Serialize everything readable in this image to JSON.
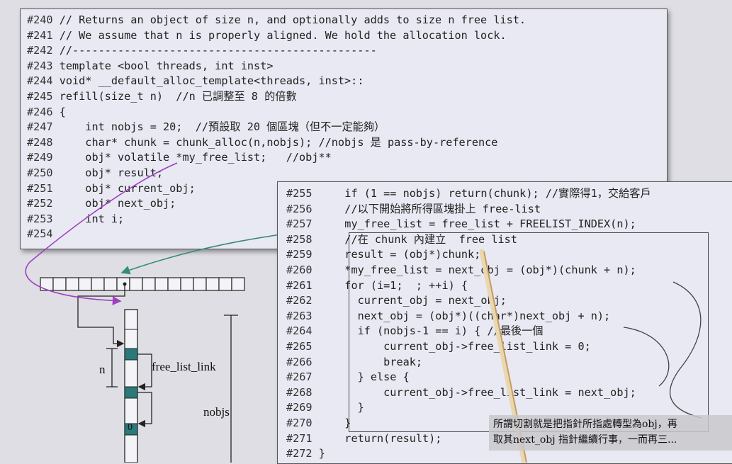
{
  "top_code": [
    {
      "num": "#240",
      "text": " // Returns an object of size n, and optionally adds to size n free list."
    },
    {
      "num": "#241",
      "text": " // We assume that n is properly aligned. We hold the allocation lock."
    },
    {
      "num": "#242",
      "text": " //-----------------------------------------------"
    },
    {
      "num": "#243",
      "text": " template <bool threads, int inst>"
    },
    {
      "num": "#244",
      "text": " void* __default_alloc_template<threads, inst>::"
    },
    {
      "num": "#245",
      "text": " refill(size_t n)  //n 已調整至 8 的倍數"
    },
    {
      "num": "#246",
      "text": " {"
    },
    {
      "num": "#247",
      "text": "     int nobjs = 20;  //預設取 20 個區塊（但不一定能夠）"
    },
    {
      "num": "#248",
      "text": "     char* chunk = chunk_alloc(n,nobjs); //nobjs 是 pass-by-reference"
    },
    {
      "num": "#249",
      "text": "     obj* volatile *my_free_list;   //obj**"
    },
    {
      "num": "#250",
      "text": "     obj* result;"
    },
    {
      "num": "#251",
      "text": "     obj* current_obj;"
    },
    {
      "num": "#252",
      "text": "     obj* next_obj;"
    },
    {
      "num": "#253",
      "text": "     int i;"
    },
    {
      "num": "#254",
      "text": ""
    }
  ],
  "bottom_code": [
    {
      "num": "#255",
      "text": "     if (1 == nobjs) return(chunk); //實際得1，交給客戶"
    },
    {
      "num": "#256",
      "text": "     //以下開始將所得區塊掛上 free-list"
    },
    {
      "num": "#257",
      "text": "     my_free_list = free_list + FREELIST_INDEX(n);"
    },
    {
      "num": "#258",
      "text": "     //在 chunk 內建立  free list"
    },
    {
      "num": "#259",
      "text": "     result = (obj*)chunk;"
    },
    {
      "num": "#260",
      "text": "     *my_free_list = next_obj = (obj*)(chunk + n);"
    },
    {
      "num": "#261",
      "text": "     for (i=1;  ; ++i) {"
    },
    {
      "num": "#262",
      "text": "       current_obj = next_obj;"
    },
    {
      "num": "#263",
      "text": "       next_obj = (obj*)((char*)next_obj + n);"
    },
    {
      "num": "#264",
      "text": "       if (nobjs-1 == i) { //最後一個"
    },
    {
      "num": "#265",
      "text": "           current_obj->free_list_link = 0;"
    },
    {
      "num": "#266",
      "text": "           break;"
    },
    {
      "num": "#267",
      "text": "       } else {"
    },
    {
      "num": "#268",
      "text": "           current_obj->free_list_link = next_obj;"
    },
    {
      "num": "#269",
      "text": "       }"
    },
    {
      "num": "#270",
      "text": "     }"
    },
    {
      "num": "#271",
      "text": "     return(result);"
    },
    {
      "num": "#272",
      "text": " }"
    }
  ],
  "diagram": {
    "label_n": "n",
    "label_free_list_link": "free_list_link",
    "label_nobjs": "nobjs",
    "label_zero": "0"
  },
  "subtitle": {
    "line1": "所謂切割就是把指針所指處轉型為obj，再",
    "line2": "取其next_obj 指針繼續行事，一而再三..."
  },
  "colors": {
    "panel": "#e8e9f2",
    "purple": "#7a1e7a",
    "teal": "#2a7a7a",
    "arrow_purple": "#a040c0",
    "arrow_green": "#3a8a7a"
  }
}
